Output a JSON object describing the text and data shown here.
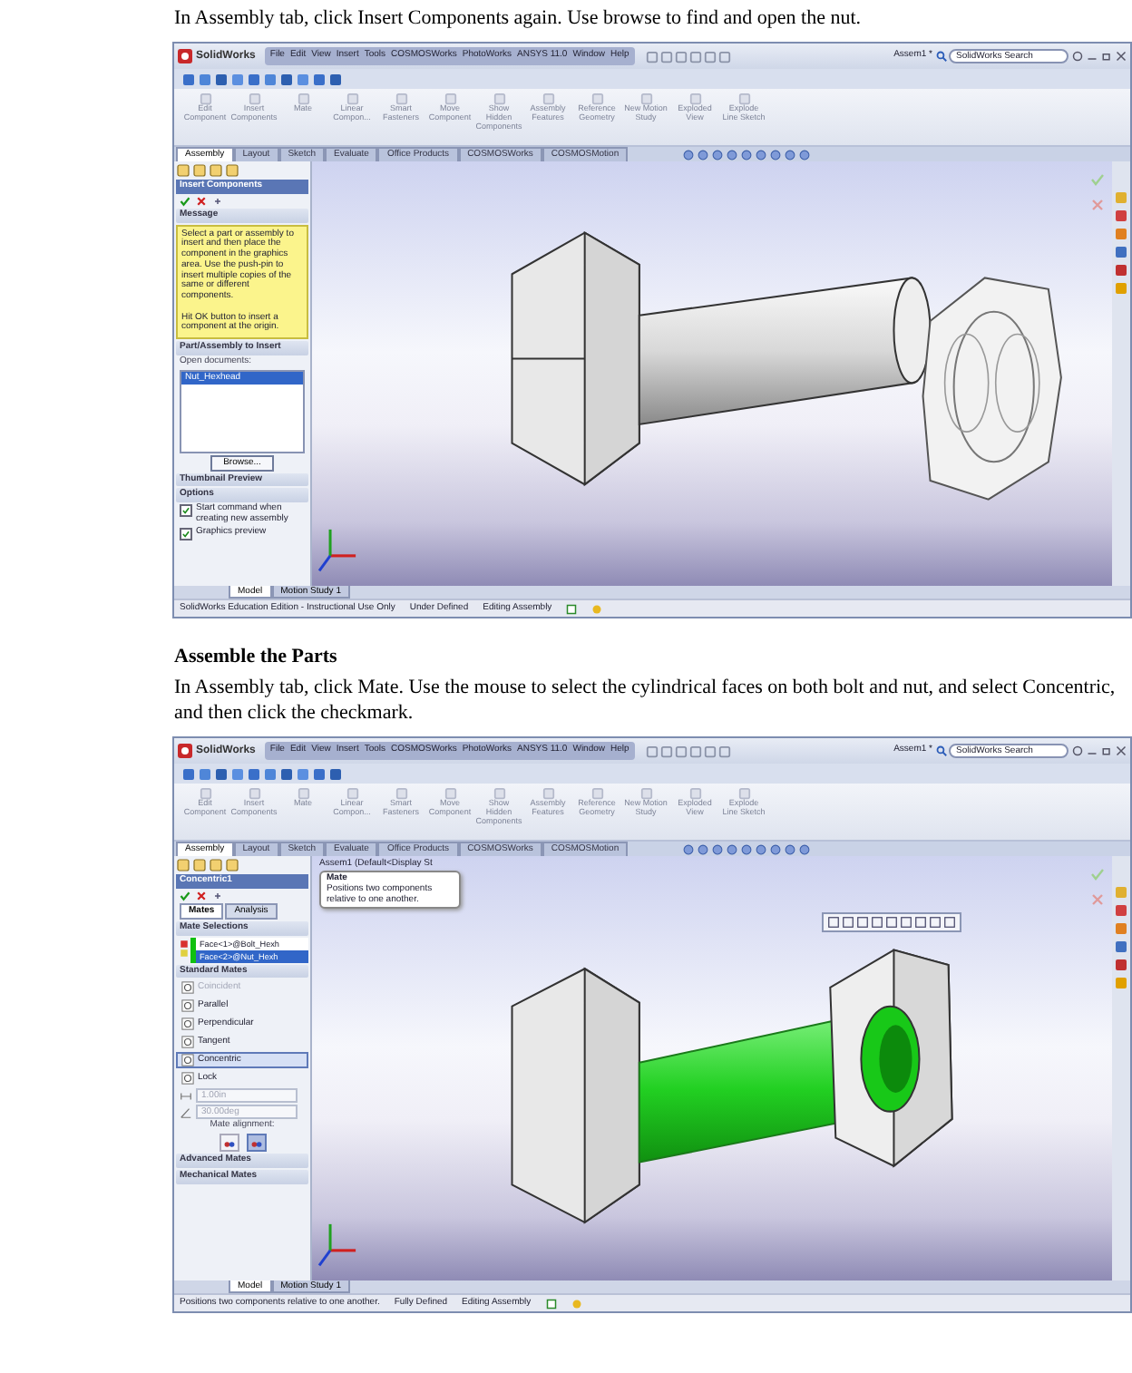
{
  "blocks": [
    {
      "kind": "paragraph",
      "text": "In Assembly tab, click Insert Components again. Use browse to find and open the nut."
    },
    {
      "kind": "screenshot",
      "app_name": "SolidWorks",
      "menu": [
        "File",
        "Edit",
        "View",
        "Insert",
        "Tools",
        "COSMOSWorks",
        "PhotoWorks",
        "ANSYS 11.0",
        "Window",
        "Help"
      ],
      "document": "Assem1 *",
      "search": {
        "placeholder": "SolidWorks Search"
      },
      "ribbon": [
        "Edit Component",
        "Insert Components",
        "Mate",
        "Linear Compon...",
        "Smart Fasteners",
        "Move Component",
        "Show Hidden Components",
        "Assembly Features",
        "Reference Geometry",
        "New Motion Study",
        "Exploded View",
        "Explode Line Sketch"
      ],
      "tabs": [
        {
          "label": "Assembly",
          "selected": true
        },
        {
          "label": "Layout",
          "selected": false
        },
        {
          "label": "Sketch",
          "selected": false
        },
        {
          "label": "Evaluate",
          "selected": false
        },
        {
          "label": "Office Products",
          "selected": false
        },
        {
          "label": "COSMOSWorks",
          "selected": false
        },
        {
          "label": "COSMOSMotion",
          "selected": false
        }
      ],
      "panel": {
        "kind": "insert",
        "title": "Insert Components",
        "message": {
          "title": "Message",
          "text": "Select a part or assembly to insert and then place the component in the graphics area. Use the push-pin to insert multiple copies of the same or different components.\n\nHit OK button to insert a component at the origin."
        },
        "part": {
          "title": "Part/Assembly to Insert",
          "label": "Open documents:",
          "items": [
            {
              "label": "Nut_Hexhead",
              "selected": true
            }
          ],
          "button": "Browse..."
        },
        "preview": {
          "title": "Thumbnail Preview"
        },
        "options": {
          "title": "Options",
          "checks": [
            {
              "label": "Start command when creating new assembly",
              "checked": true
            },
            {
              "label": "Graphics preview",
              "checked": true
            }
          ]
        }
      },
      "model": {
        "kind": "separate"
      },
      "bottom_tabs": [
        {
          "label": "Model",
          "selected": true
        },
        {
          "label": "Motion Study 1",
          "selected": false
        }
      ],
      "status": {
        "message": "SolidWorks Education Edition - Instructional Use Only",
        "state": "Under Defined",
        "mode": "Editing Assembly"
      }
    },
    {
      "kind": "heading",
      "text": "Assemble the Parts"
    },
    {
      "kind": "paragraph",
      "text": "In Assembly tab, click Mate. Use the mouse to select the cylindrical faces on both bolt and nut, and select Concentric, and then click the checkmark."
    },
    {
      "kind": "screenshot",
      "app_name": "SolidWorks",
      "menu": [
        "File",
        "Edit",
        "View",
        "Insert",
        "Tools",
        "COSMOSWorks",
        "PhotoWorks",
        "ANSYS 11.0",
        "Window",
        "Help"
      ],
      "document": "Assem1 *",
      "search": {
        "placeholder": "SolidWorks Search"
      },
      "ribbon": [
        "Edit Component",
        "Insert Components",
        "Mate",
        "Linear Compon...",
        "Smart Fasteners",
        "Move Component",
        "Show Hidden Components",
        "Assembly Features",
        "Reference Geometry",
        "New Motion Study",
        "Exploded View",
        "Explode Line Sketch"
      ],
      "tabs": [
        {
          "label": "Assembly",
          "selected": true
        },
        {
          "label": "Layout",
          "selected": false
        },
        {
          "label": "Sketch",
          "selected": false
        },
        {
          "label": "Evaluate",
          "selected": false
        },
        {
          "label": "Office Products",
          "selected": false
        },
        {
          "label": "COSMOSWorks",
          "selected": false
        },
        {
          "label": "COSMOSMotion",
          "selected": false
        }
      ],
      "tooltip": {
        "title": "Mate",
        "text": "Positions two components relative to one another."
      },
      "tree_header": "Assem1 (Default<Display St",
      "panel": {
        "kind": "mate",
        "title": "Concentric1",
        "tabs": [
          {
            "label": "Mates",
            "selected": true
          },
          {
            "label": "Analysis",
            "selected": false
          }
        ],
        "selections": {
          "title": "Mate Selections",
          "items": [
            {
              "label": "Face<1>@Bolt_Hexh",
              "selected": false
            },
            {
              "label": "Face<2>@Nut_Hexh",
              "selected": true
            }
          ]
        },
        "standard": {
          "title": "Standard Mates",
          "mates": [
            {
              "label": "Coincident",
              "disabled": true,
              "selected": false
            },
            {
              "label": "Parallel",
              "disabled": false,
              "selected": false
            },
            {
              "label": "Perpendicular",
              "disabled": false,
              "selected": false
            },
            {
              "label": "Tangent",
              "disabled": false,
              "selected": false
            },
            {
              "label": "Concentric",
              "disabled": false,
              "selected": true
            },
            {
              "label": "Lock",
              "disabled": false,
              "selected": false
            }
          ],
          "distance": "1.00in",
          "angle": "30.00deg",
          "alignment_label": "Mate alignment:",
          "alignment": [
            {
              "selected": false
            },
            {
              "selected": true
            }
          ]
        },
        "collapsed": [
          "Advanced Mates",
          "Mechanical Mates"
        ]
      },
      "model": {
        "kind": "mated"
      },
      "bottom_tabs": [
        {
          "label": "Model",
          "selected": true
        },
        {
          "label": "Motion Study 1",
          "selected": false
        }
      ],
      "status": {
        "message": "Positions two components relative to one another.",
        "state": "Fully Defined",
        "mode": "Editing Assembly"
      }
    }
  ]
}
